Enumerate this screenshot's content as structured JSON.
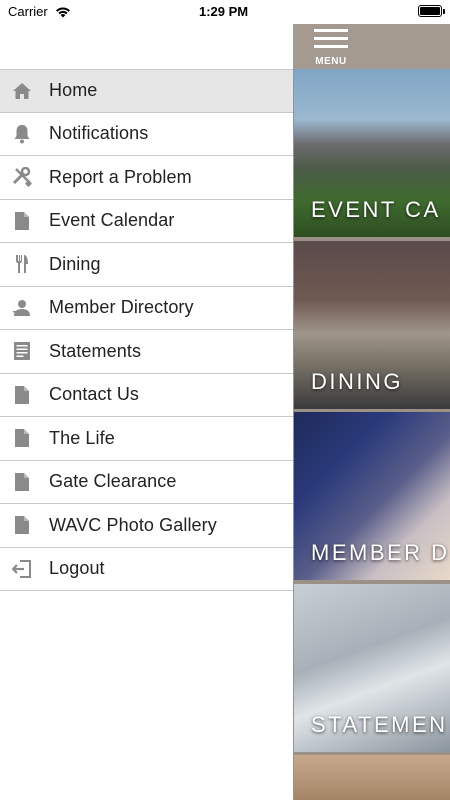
{
  "status_bar": {
    "carrier": "Carrier",
    "time": "1:29 PM"
  },
  "menu": {
    "items": [
      {
        "label": "Home",
        "icon": "home-icon",
        "active": true
      },
      {
        "label": "Notifications",
        "icon": "bell-icon"
      },
      {
        "label": "Report a Problem",
        "icon": "tools-icon"
      },
      {
        "label": "Event Calendar",
        "icon": "document-icon"
      },
      {
        "label": "Dining",
        "icon": "fork-knife-icon"
      },
      {
        "label": "Member Directory",
        "icon": "person-icon"
      },
      {
        "label": "Statements",
        "icon": "statement-icon"
      },
      {
        "label": "Contact Us",
        "icon": "document-icon"
      },
      {
        "label": "The Life",
        "icon": "document-icon"
      },
      {
        "label": "Gate Clearance",
        "icon": "document-icon"
      },
      {
        "label": "WAVC Photo Gallery",
        "icon": "document-icon"
      },
      {
        "label": "Logout",
        "icon": "logout-icon"
      }
    ]
  },
  "header": {
    "menu_label": "MENU"
  },
  "tiles": [
    {
      "label": "EVENT CA"
    },
    {
      "label": "DINING"
    },
    {
      "label": "MEMBER D"
    },
    {
      "label": "STATEMEN"
    },
    {
      "label": ""
    }
  ],
  "colors": {
    "icon": "#8a8a8a",
    "active_row": "#e6e6e6",
    "header": "#a49a8f"
  }
}
